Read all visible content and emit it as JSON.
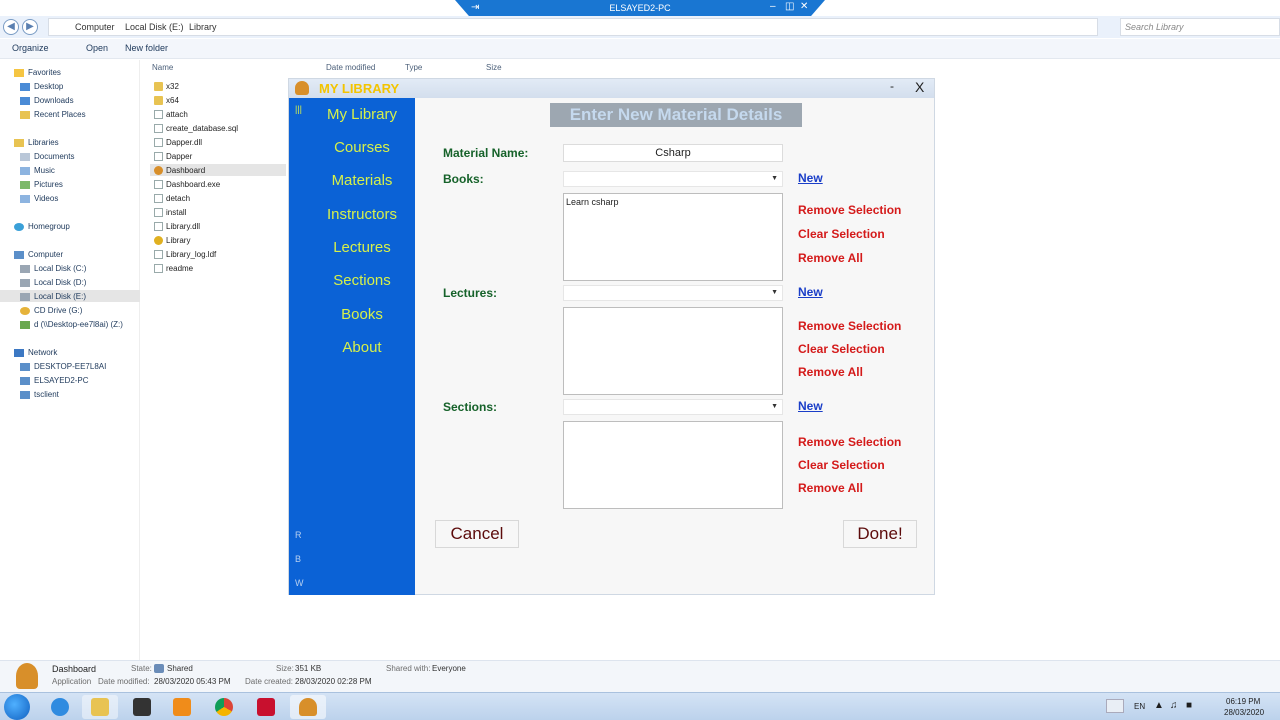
{
  "rdp": {
    "title": "ELSAYED2-PC"
  },
  "explorer": {
    "breadcrumb": [
      "Computer",
      "Local Disk (E:)",
      "Library"
    ],
    "search_placeholder": "Search Library",
    "toolbar": {
      "organize": "Organize",
      "open": "Open",
      "new_folder": "New folder"
    },
    "columns": {
      "name": "Name",
      "date_modified": "Date modified",
      "type": "Type",
      "size": "Size"
    },
    "nav": {
      "favorites": "Favorites",
      "favorites_items": [
        "Desktop",
        "Downloads",
        "Recent Places"
      ],
      "libraries": "Libraries",
      "libraries_items": [
        "Documents",
        "Music",
        "Pictures",
        "Videos"
      ],
      "homegroup": "Homegroup",
      "computer": "Computer",
      "computer_items": [
        "Local Disk (C:)",
        "Local Disk (D:)",
        "Local Disk (E:)",
        "CD Drive (G:)",
        "d (\\\\Desktop-ee7l8ai) (Z:)"
      ],
      "network": "Network",
      "network_items": [
        "DESKTOP-EE7L8AI",
        "ELSAYED2-PC",
        "tsclient"
      ]
    },
    "files": [
      "x32",
      "x64",
      "attach",
      "create_database.sql",
      "Dapper.dll",
      "Dapper",
      "Dashboard",
      "Dashboard.exe",
      "detach",
      "install",
      "Library.dll",
      "Library",
      "Library_log.ldf",
      "readme"
    ],
    "details": {
      "name": "Dashboard",
      "kind": "Application",
      "state_label": "State:",
      "state": "Shared",
      "date_modified_label": "Date modified:",
      "date_modified": "28/03/2020 05:43 PM",
      "size_label": "Size:",
      "size": "351 KB",
      "date_created_label": "Date created:",
      "date_created": "28/03/2020 02:28 PM",
      "shared_label": "Shared with:",
      "shared": "Everyone"
    }
  },
  "app": {
    "title": "MY LIBRARY",
    "minimize": "-",
    "close": "X",
    "menu_icon": "|||",
    "menu": [
      "My Library",
      "Courses",
      "Materials",
      "Instructors",
      "Lectures",
      "Sections",
      "Books",
      "About"
    ],
    "side_letters": [
      "R",
      "B",
      "W"
    ],
    "heading": "Enter New Material Details",
    "material_name_label": "Material Name:",
    "material_name_value": "Csharp",
    "books_label": "Books:",
    "books_list": [
      "Learn csharp"
    ],
    "lectures_label": "Lectures:",
    "sections_label": "Sections:",
    "new_label": "New",
    "remove_selection": "Remove Selection",
    "clear_selection": "Clear Selection",
    "remove_all": "Remove All",
    "cancel": "Cancel",
    "done": "Done!"
  },
  "tray": {
    "lang": "EN",
    "time": "06:19 PM",
    "date": "28/03/2020"
  }
}
